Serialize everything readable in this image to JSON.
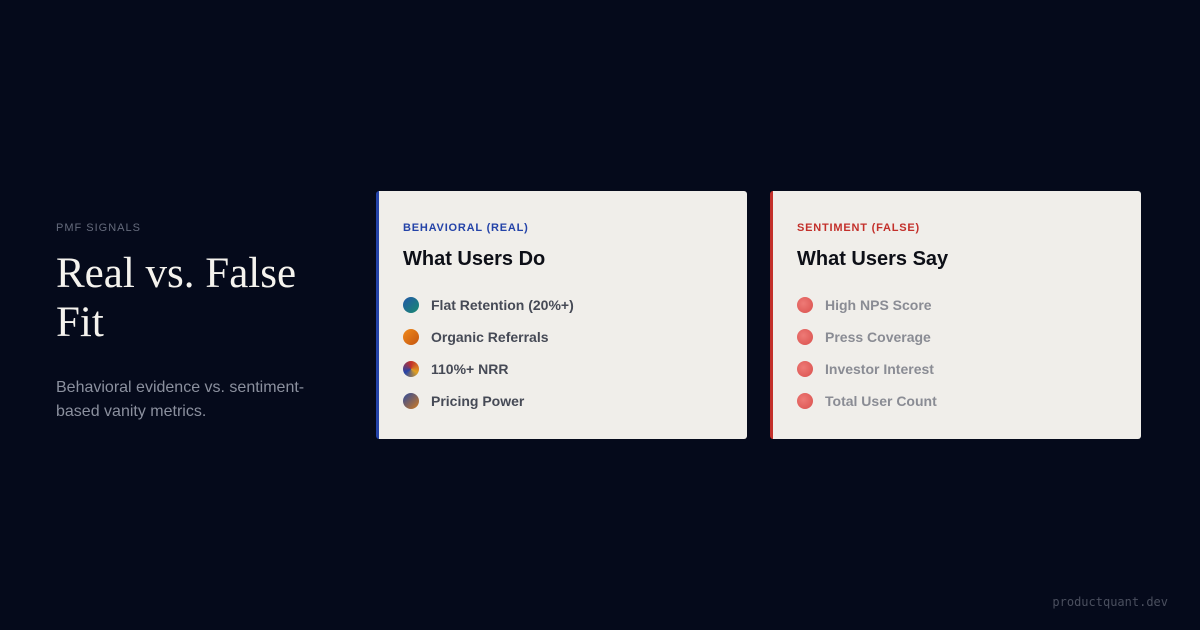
{
  "intro": {
    "eyebrow": "PMF SIGNALS",
    "headline": "Real vs. False Fit",
    "subtitle": "Behavioral evidence vs. sentiment-based vanity metrics."
  },
  "cards": {
    "real": {
      "label": "BEHAVIORAL (REAL)",
      "title": "What Users Do",
      "accent": "#2443a8",
      "items": [
        {
          "label": "Flat Retention (20%+)",
          "icon": "retention-dot-icon"
        },
        {
          "label": "Organic Referrals",
          "icon": "referral-dot-icon"
        },
        {
          "label": "110%+ NRR",
          "icon": "nrr-dot-icon"
        },
        {
          "label": "Pricing Power",
          "icon": "pricing-dot-icon"
        }
      ]
    },
    "false": {
      "label": "SENTIMENT (FALSE)",
      "title": "What Users Say",
      "accent": "#c3302b",
      "items": [
        {
          "label": "High NPS Score",
          "icon": "red-dot-icon"
        },
        {
          "label": "Press Coverage",
          "icon": "red-dot-icon"
        },
        {
          "label": "Investor Interest",
          "icon": "red-dot-icon"
        },
        {
          "label": "Total User Count",
          "icon": "red-dot-icon"
        }
      ]
    }
  },
  "footer": {
    "domain": "productquant.dev"
  },
  "colors": {
    "background": "#050a1b",
    "card": "#f0eeea",
    "real_accent": "#2443a8",
    "false_accent": "#c3302b"
  }
}
